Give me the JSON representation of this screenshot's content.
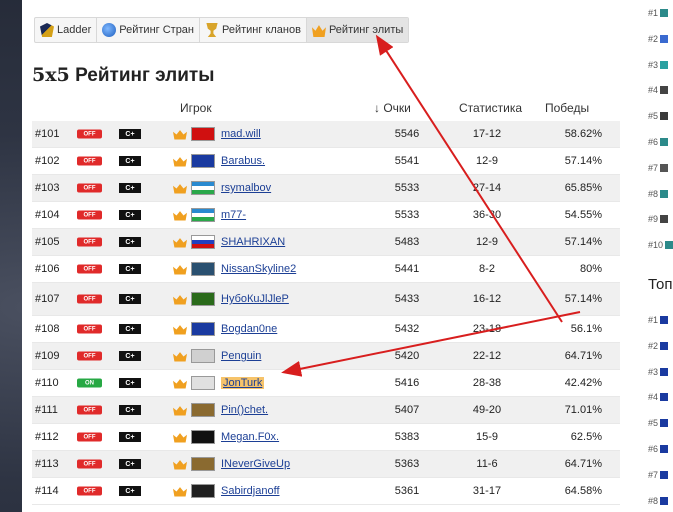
{
  "tabs": [
    {
      "label": "Ladder",
      "icon": "ladder-icon",
      "active": false
    },
    {
      "label": "Рейтинг Стран",
      "icon": "globe-icon",
      "active": false
    },
    {
      "label": "Рейтинг кланов",
      "icon": "trophy-icon",
      "active": false
    },
    {
      "label": "Рейтинг элиты",
      "icon": "crown-icon",
      "active": true
    }
  ],
  "page": {
    "title_prefix": "5x5",
    "title": "Рейтинг элиты"
  },
  "columns": {
    "player": "Игрок",
    "points": "↓ Очки",
    "stats": "Статистика",
    "wins": "Победы"
  },
  "rows": [
    {
      "rank": "#101",
      "status": "OFF",
      "badge": "C+",
      "name": "mad.will",
      "points": "5546",
      "stats": "17-12",
      "wins": "58.62%"
    },
    {
      "rank": "#102",
      "status": "OFF",
      "badge": "C+",
      "name": "Barabus.",
      "points": "5541",
      "stats": "12-9",
      "wins": "57.14%"
    },
    {
      "rank": "#103",
      "status": "OFF",
      "badge": "C+",
      "name": "rsymalbov",
      "points": "5533",
      "stats": "27-14",
      "wins": "65.85%"
    },
    {
      "rank": "#104",
      "status": "OFF",
      "badge": "C+",
      "name": "m77-",
      "points": "5533",
      "stats": "36-30",
      "wins": "54.55%"
    },
    {
      "rank": "#105",
      "status": "OFF",
      "badge": "C+",
      "name": "SHAHRIXAN",
      "points": "5483",
      "stats": "12-9",
      "wins": "57.14%"
    },
    {
      "rank": "#106",
      "status": "OFF",
      "badge": "C+",
      "name": "NissanSkyline2",
      "points": "5441",
      "stats": "8-2",
      "wins": "80%"
    },
    {
      "rank": "#107",
      "status": "OFF",
      "badge": "C+",
      "name": "НубоКuJlJleP",
      "points": "5433",
      "stats": "16-12",
      "wins": "57.14%"
    },
    {
      "rank": "#108",
      "status": "OFF",
      "badge": "C+",
      "name": "Bogdan0ne",
      "points": "5432",
      "stats": "23-18",
      "wins": "56.1%"
    },
    {
      "rank": "#109",
      "status": "OFF",
      "badge": "C+",
      "name": "Penguin",
      "points": "5420",
      "stats": "22-12",
      "wins": "64.71%"
    },
    {
      "rank": "#110",
      "status": "ON",
      "badge": "C+",
      "name": "JonTurk",
      "points": "5416",
      "stats": "28-38",
      "wins": "42.42%"
    },
    {
      "rank": "#111",
      "status": "OFF",
      "badge": "C+",
      "name": "Pin()chet.",
      "points": "5407",
      "stats": "49-20",
      "wins": "71.01%"
    },
    {
      "rank": "#112",
      "status": "OFF",
      "badge": "C+",
      "name": "Megan.F0x.",
      "points": "5383",
      "stats": "15-9",
      "wins": "62.5%"
    },
    {
      "rank": "#113",
      "status": "OFF",
      "badge": "C+",
      "name": "INeverGiveUp",
      "points": "5363",
      "stats": "11-6",
      "wins": "64.71%"
    },
    {
      "rank": "#114",
      "status": "OFF",
      "badge": "C+",
      "name": "Sabirdjanoff",
      "points": "5361",
      "stats": "31-17",
      "wins": "64.58%"
    }
  ],
  "sidebar": {
    "ranks": [
      "#1",
      "#2",
      "#3",
      "#4",
      "#5",
      "#6",
      "#7",
      "#8",
      "#9",
      "#10"
    ],
    "title": "Топ",
    "ranks2": [
      "#1",
      "#2",
      "#3",
      "#4",
      "#5",
      "#6",
      "#7",
      "#8"
    ]
  }
}
